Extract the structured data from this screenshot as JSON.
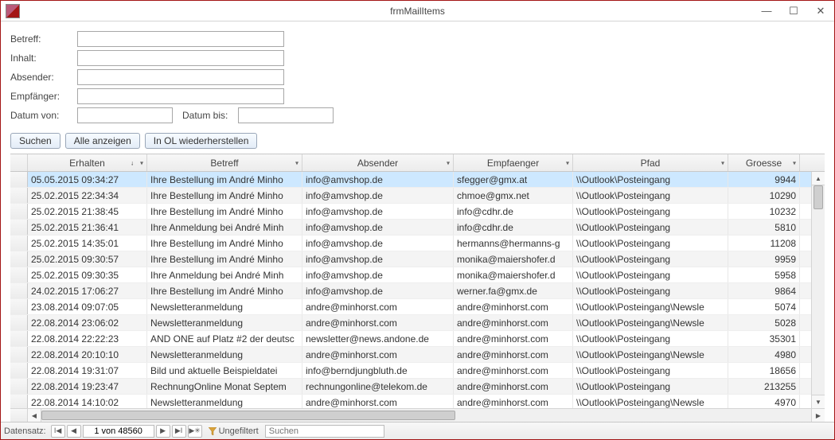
{
  "window": {
    "title": "frmMailItems"
  },
  "form": {
    "labels": {
      "betreff": "Betreff:",
      "inhalt": "Inhalt:",
      "absender": "Absender:",
      "empfaenger": "Empfänger:",
      "datum_von": "Datum von:",
      "datum_bis": "Datum bis:"
    },
    "values": {
      "betreff": "",
      "inhalt": "",
      "absender": "",
      "empfaenger": "",
      "datum_von": "",
      "datum_bis": ""
    }
  },
  "buttons": {
    "suchen": "Suchen",
    "alle_anzeigen": "Alle anzeigen",
    "in_ol_wiederherstellen": "In OL wiederherstellen"
  },
  "columns": {
    "erhalten": "Erhalten",
    "betreff": "Betreff",
    "absender": "Absender",
    "empfaenger": "Empfaenger",
    "pfad": "Pfad",
    "groesse": "Groesse"
  },
  "rows": [
    {
      "erhalten": "05.05.2015 09:34:27",
      "betreff": "Ihre Bestellung im André Minho",
      "absender": "info@amvshop.de",
      "empfaenger": "sfegger@gmx.at",
      "pfad": "\\\\Outlook\\Posteingang",
      "groesse": "9944",
      "selected": true
    },
    {
      "erhalten": "25.02.2015 22:34:34",
      "betreff": "Ihre Bestellung im André Minho",
      "absender": "info@amvshop.de",
      "empfaenger": "chmoe@gmx.net",
      "pfad": "\\\\Outlook\\Posteingang",
      "groesse": "10290"
    },
    {
      "erhalten": "25.02.2015 21:38:45",
      "betreff": "Ihre Bestellung im André Minho",
      "absender": "info@amvshop.de",
      "empfaenger": "info@cdhr.de",
      "pfad": "\\\\Outlook\\Posteingang",
      "groesse": "10232"
    },
    {
      "erhalten": "25.02.2015 21:36:41",
      "betreff": "Ihre Anmeldung bei André Minh",
      "absender": "info@amvshop.de",
      "empfaenger": "info@cdhr.de",
      "pfad": "\\\\Outlook\\Posteingang",
      "groesse": "5810"
    },
    {
      "erhalten": "25.02.2015 14:35:01",
      "betreff": "Ihre Bestellung im André Minho",
      "absender": "info@amvshop.de",
      "empfaenger": "hermanns@hermanns-g",
      "pfad": "\\\\Outlook\\Posteingang",
      "groesse": "11208"
    },
    {
      "erhalten": "25.02.2015 09:30:57",
      "betreff": "Ihre Bestellung im André Minho",
      "absender": "info@amvshop.de",
      "empfaenger": "monika@maiershofer.d",
      "pfad": "\\\\Outlook\\Posteingang",
      "groesse": "9959"
    },
    {
      "erhalten": "25.02.2015 09:30:35",
      "betreff": "Ihre Anmeldung bei André Minh",
      "absender": "info@amvshop.de",
      "empfaenger": "monika@maiershofer.d",
      "pfad": "\\\\Outlook\\Posteingang",
      "groesse": "5958"
    },
    {
      "erhalten": "24.02.2015 17:06:27",
      "betreff": "Ihre Bestellung im André Minho",
      "absender": "info@amvshop.de",
      "empfaenger": "werner.fa@gmx.de",
      "pfad": "\\\\Outlook\\Posteingang",
      "groesse": "9864"
    },
    {
      "erhalten": "23.08.2014 09:07:05",
      "betreff": "Newsletteranmeldung",
      "absender": "andre@minhorst.com",
      "empfaenger": "andre@minhorst.com",
      "pfad": "\\\\Outlook\\Posteingang\\Newsle",
      "groesse": "5074"
    },
    {
      "erhalten": "22.08.2014 23:06:02",
      "betreff": "Newsletteranmeldung",
      "absender": "andre@minhorst.com",
      "empfaenger": "andre@minhorst.com",
      "pfad": "\\\\Outlook\\Posteingang\\Newsle",
      "groesse": "5028"
    },
    {
      "erhalten": "22.08.2014 22:22:23",
      "betreff": "AND ONE auf Platz #2 der deutsc",
      "absender": "newsletter@news.andone.de",
      "empfaenger": "andre@minhorst.com",
      "pfad": "\\\\Outlook\\Posteingang",
      "groesse": "35301"
    },
    {
      "erhalten": "22.08.2014 20:10:10",
      "betreff": "Newsletteranmeldung",
      "absender": "andre@minhorst.com",
      "empfaenger": "andre@minhorst.com",
      "pfad": "\\\\Outlook\\Posteingang\\Newsle",
      "groesse": "4980"
    },
    {
      "erhalten": "22.08.2014 19:31:07",
      "betreff": "Bild und aktuelle Beispieldatei",
      "absender": "info@berndjungbluth.de",
      "empfaenger": "andre@minhorst.com",
      "pfad": "\\\\Outlook\\Posteingang",
      "groesse": "18656"
    },
    {
      "erhalten": "22.08.2014 19:23:47",
      "betreff": "RechnungOnline Monat Septem",
      "absender": "rechnungonline@telekom.de",
      "empfaenger": "andre@minhorst.com",
      "pfad": "\\\\Outlook\\Posteingang",
      "groesse": "213255"
    },
    {
      "erhalten": "22.08.2014 14:10:02",
      "betreff": "Newsletteranmeldung",
      "absender": "andre@minhorst.com",
      "empfaenger": "andre@minhorst.com",
      "pfad": "\\\\Outlook\\Posteingang\\Newsle",
      "groesse": "4970"
    }
  ],
  "nav": {
    "label": "Datensatz:",
    "position": "1 von 48560",
    "filter": "Ungefiltert",
    "search_placeholder": "Suchen"
  }
}
